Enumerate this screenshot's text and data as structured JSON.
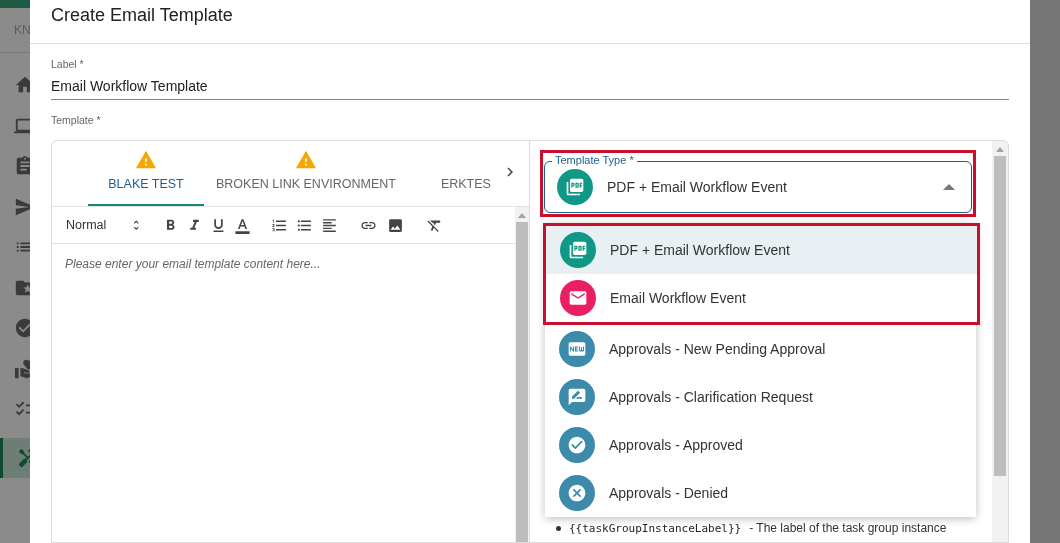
{
  "app": {
    "brand": "KN",
    "sidebar": [
      {
        "selected": false
      },
      {
        "selected": false
      },
      {
        "selected": false
      },
      {
        "selected": false
      },
      {
        "selected": false
      },
      {
        "selected": false
      },
      {
        "selected": false
      },
      {
        "selected": false
      },
      {
        "selected": false
      },
      {
        "selected": true
      }
    ]
  },
  "dialog": {
    "title": "Create Email Template",
    "label_field": {
      "label": "Label *",
      "value": "Email Workflow Template"
    },
    "template_label": "Template *",
    "tabs": [
      {
        "label": "BLAKE TEST",
        "warning": true,
        "selected": true
      },
      {
        "label": "BROKEN LINK ENVIRONMENT",
        "warning": true,
        "selected": false
      },
      {
        "label": "ERKTES",
        "warning": false,
        "selected": false
      }
    ],
    "toolbar": {
      "format": "Normal"
    },
    "editor": {
      "placeholder": "Please enter your email template content here..."
    },
    "template_type": {
      "label": "Template Type *",
      "value": "PDF + Email Workflow Event",
      "expanded": true,
      "highlighted": true,
      "options": [
        {
          "label": "PDF + Email Workflow Event",
          "kind": "pdf",
          "color": "#109886",
          "selected": true,
          "highlighted": true
        },
        {
          "label": "Email Workflow Event",
          "kind": "mail",
          "color": "#ea1e63",
          "selected": false,
          "highlighted": true
        },
        {
          "label": "Approvals - New Pending Approval",
          "kind": "new",
          "color": "#3d8bab",
          "selected": false,
          "highlighted": false
        },
        {
          "label": "Approvals - Clarification Request",
          "kind": "comment",
          "color": "#3d8bab",
          "selected": false,
          "highlighted": false
        },
        {
          "label": "Approvals - Approved",
          "kind": "approved",
          "color": "#3d8bab",
          "selected": false,
          "highlighted": false
        },
        {
          "label": "Approvals - Denied",
          "kind": "denied",
          "color": "#3d8bab",
          "selected": false,
          "highlighted": false
        }
      ]
    },
    "variables": [
      {
        "code": "{{taskGroupInstanceLabel}}",
        "text": "- The label of the task group instance"
      }
    ]
  }
}
